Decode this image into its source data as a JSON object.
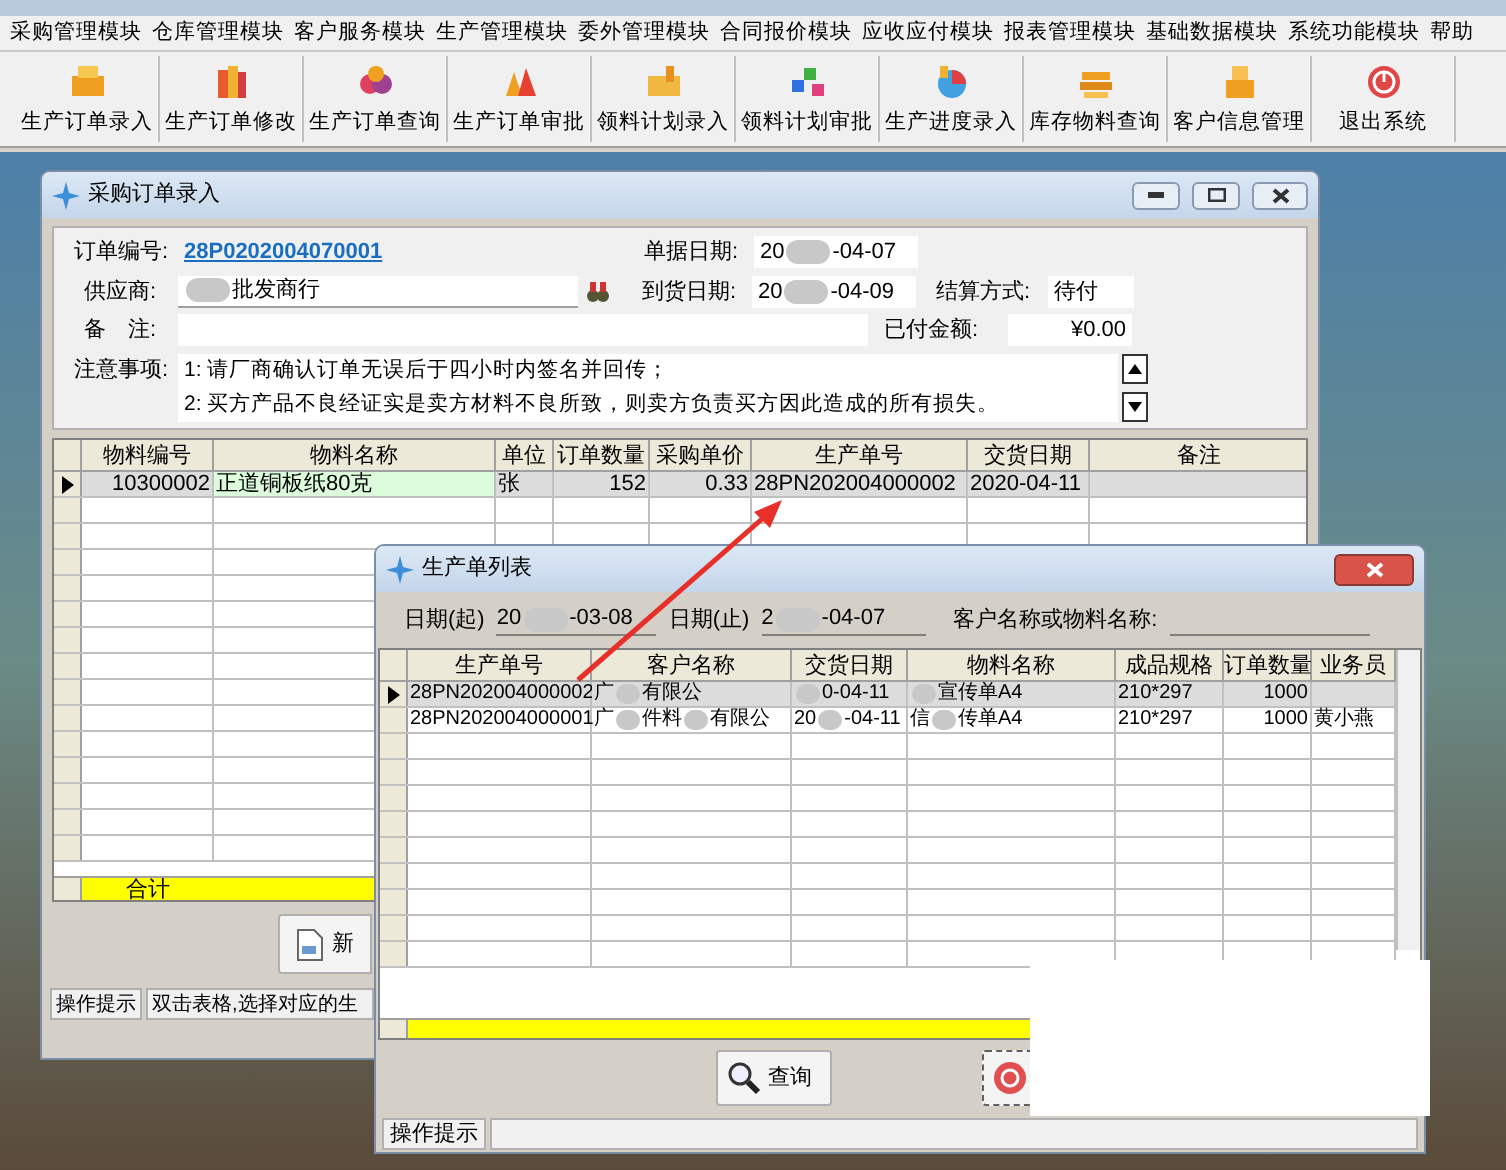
{
  "menu": [
    "采购管理模块",
    "仓库管理模块",
    "客户服务模块",
    "生产管理模块",
    "委外管理模块",
    "合同报价模块",
    "应收应付模块",
    "报表管理模块",
    "基础数据模块",
    "系统功能模块",
    "帮助"
  ],
  "toolbar": [
    {
      "label": "生产订单录入",
      "kind": "box"
    },
    {
      "label": "生产订单修改",
      "kind": "books"
    },
    {
      "label": "生产订单查询",
      "kind": "balls"
    },
    {
      "label": "生产订单审批",
      "kind": "bells"
    },
    {
      "label": "领料计划录入",
      "kind": "folder"
    },
    {
      "label": "领料计划审批",
      "kind": "cubes"
    },
    {
      "label": "生产进度录入",
      "kind": "pie"
    },
    {
      "label": "库存物料查询",
      "kind": "stack"
    },
    {
      "label": "客户信息管理",
      "kind": "boxes"
    },
    {
      "label": "退出系统",
      "kind": "power"
    }
  ],
  "purchase_window": {
    "title": "采购订单录入",
    "order_no": {
      "label": "订单编号:",
      "value": "28P0202004070001"
    },
    "doc_date": {
      "label": "单据日期:",
      "parts": [
        "20",
        "-04-07"
      ]
    },
    "supplier": {
      "label": "供应商:",
      "parts": [
        "批发商行"
      ],
      "lead_blur": true
    },
    "arrival_date": {
      "label": "到货日期:",
      "parts": [
        "20",
        "-04-09"
      ]
    },
    "settlement": {
      "label": "结算方式:",
      "value": "待付"
    },
    "remark": {
      "label": "备　注:"
    },
    "paid": {
      "label": "已付金额:",
      "value": "¥0.00"
    },
    "notes": {
      "label": "注意事项:",
      "lines": [
        "1: 请厂商确认订单无误后于四小时内签名并回传；",
        "2: 买方产品不良经证实是卖方材料不良所致，则卖方负责买方因此造成的所有损失。"
      ]
    },
    "columns": [
      "物料编号",
      "物料名称",
      "单位",
      "订单数量",
      "采购单价",
      "生产单号",
      "交货日期",
      "备注"
    ],
    "rows": [
      {
        "selected": true,
        "cells": [
          "10300002",
          "正道铜板纸80克",
          "张",
          "152",
          "0.33",
          "28PN202004000002",
          "2020-04-11"
        ]
      }
    ],
    "total_label": "合计",
    "new_button": "新",
    "status": {
      "label": "操作提示",
      "text": "双击表格,选择对应的生"
    }
  },
  "production_window": {
    "title": "生产单列表",
    "date_from": {
      "label": "日期(起)",
      "parts": [
        "20",
        "-03-08"
      ]
    },
    "date_to": {
      "label": "日期(止)",
      "parts": [
        "2",
        "-04-07"
      ]
    },
    "search": {
      "label": "客户名称或物料名称:"
    },
    "columns": [
      "生产单号",
      "客户名称",
      "交货日期",
      "物料名称",
      "成品规格",
      "订单数量",
      "业务员"
    ],
    "rows": [
      {
        "selected": true,
        "cells": [
          "28PN202004000002",
          {
            "parts": [
              "广",
              "有限公"
            ]
          },
          {
            "parts": [
              "0-04-11"
            ],
            "lead_blur": true
          },
          {
            "parts": [
              "宣传单A4"
            ],
            "lead_blur": true
          },
          "210*297",
          "1000"
        ]
      },
      {
        "selected": false,
        "cells": [
          "28PN202004000001",
          {
            "parts": [
              "广",
              "件料",
              "有限公"
            ]
          },
          {
            "parts": [
              "20",
              "-04-11"
            ]
          },
          {
            "parts": [
              "信",
              "传单A4"
            ]
          },
          "210*297",
          "1000",
          "黄小燕"
        ]
      }
    ],
    "query_button": "查询",
    "status": {
      "label": "操作提示"
    }
  }
}
